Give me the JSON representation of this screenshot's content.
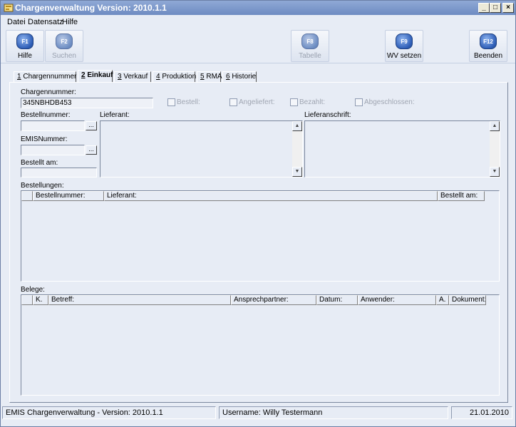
{
  "window": {
    "title": "Chargenverwaltung Version: 2010.1.1",
    "controls": {
      "minimize": "_",
      "maximize": "□",
      "close": "×"
    }
  },
  "menu": [
    "Datei",
    "Datensatz",
    "Hilfe"
  ],
  "toolbar": {
    "buttons": [
      {
        "key": "F1",
        "label": "Hilfe",
        "enabled": true
      },
      {
        "key": "F2",
        "label": "Suchen",
        "enabled": false
      },
      {
        "key": "F8",
        "label": "Tabelle",
        "enabled": false
      },
      {
        "key": "F9",
        "label": "WV setzen",
        "enabled": true
      },
      {
        "key": "F12",
        "label": "Beenden",
        "enabled": true
      }
    ]
  },
  "tabs": [
    {
      "num": "1",
      "label": " Chargennummer",
      "active": false
    },
    {
      "num": "2",
      "label": " Einkauf",
      "active": true
    },
    {
      "num": "3",
      "label": " Verkauf",
      "active": false
    },
    {
      "num": "4",
      "label": " Produktion",
      "active": false
    },
    {
      "num": "5",
      "label": " RMA",
      "active": false
    },
    {
      "num": "6",
      "label": " Historie",
      "active": false
    }
  ],
  "form": {
    "chargennummer_label": "Chargennummer:",
    "chargennummer_value": "345NBHDB453",
    "checkboxes": [
      "Bestell:",
      "Angeliefert:",
      "Bezahlt:",
      "Abgeschlossen:"
    ],
    "bestellnummer_label": "Bestellnummer:",
    "bestellnummer_value": "",
    "emisnummer_label": "EMISNummer:",
    "emisnummer_value": "",
    "bestellt_am_label": "Bestellt am:",
    "bestellt_am_value": "",
    "lieferant_label": "Lieferant:",
    "lieferanschrift_label": "Lieferanschrift:",
    "ellipsis": "..."
  },
  "bestellungen": {
    "label": "Bestellungen:",
    "columns": [
      "",
      "Bestellnummer:",
      "Lieferant:",
      "Bestellt am:"
    ],
    "rows": []
  },
  "belege": {
    "label": "Belege:",
    "columns": [
      "",
      "K.",
      "Betreff:",
      "Ansprechpartner:",
      "Datum:",
      "Anwender:",
      "A.",
      "Dokument:"
    ],
    "rows": []
  },
  "statusbar": {
    "app": "EMIS Chargenverwaltung - Version: 2010.1.1",
    "user": "Username: Willy Testermann",
    "date": "21.01.2010"
  }
}
